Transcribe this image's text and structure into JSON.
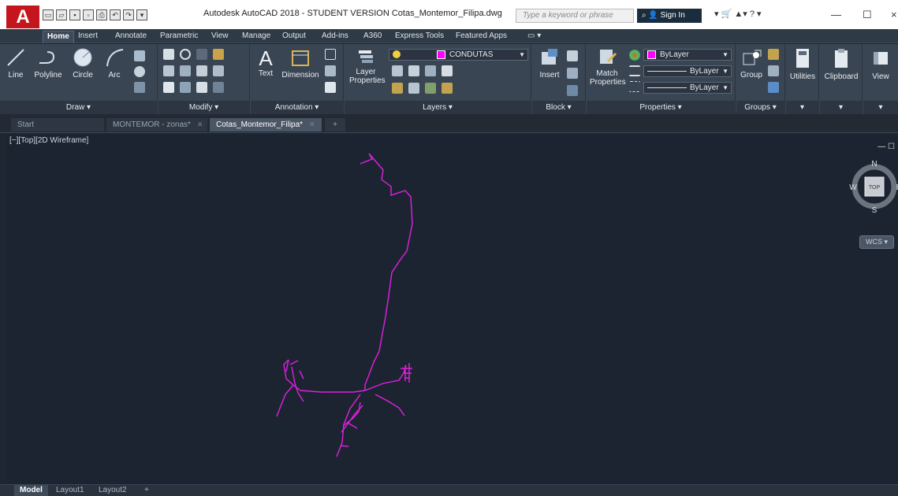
{
  "app": {
    "logo": "A",
    "window_title": "Autodesk AutoCAD 2018 - STUDENT VERSION    Cotas_Montemor_Filipa.dwg",
    "search_placeholder": "Type a keyword or phrase",
    "sign_in": "Sign In",
    "minimize": "—",
    "maximize": "☐",
    "close": "×"
  },
  "ribbon_tabs": [
    "Home",
    "Insert",
    "Annotate",
    "Parametric",
    "View",
    "Manage",
    "Output",
    "Add-ins",
    "A360",
    "Express Tools",
    "Featured Apps"
  ],
  "panels": {
    "draw": {
      "title": "Draw ▾",
      "line": "Line",
      "polyline": "Polyline",
      "circle": "Circle",
      "arc": "Arc"
    },
    "modify": {
      "title": "Modify ▾"
    },
    "annotation": {
      "title": "Annotation ▾",
      "text": "Text",
      "dimension": "Dimension"
    },
    "layers": {
      "title": "Layers ▾",
      "layer_properties_1": "Layer",
      "layer_properties_2": "Properties",
      "current_layer": "CONDUTAS"
    },
    "block": {
      "title": "Block ▾",
      "insert": "Insert"
    },
    "properties": {
      "title": "Properties ▾",
      "match_1": "Match",
      "match_2": "Properties",
      "color": "ByLayer",
      "linetype": "ByLayer",
      "lineweight": "ByLayer"
    },
    "groups": {
      "title": "Groups ▾",
      "group": "Group"
    },
    "utilities": {
      "label": "Utilities"
    },
    "clipboard": {
      "label": "Clipboard"
    },
    "view": {
      "label": "View"
    }
  },
  "doc_tabs": {
    "start": "Start",
    "tab1": "MONTEMOR - zonas*",
    "tab2": "Cotas_Montemor_Filipa*",
    "new": "+"
  },
  "viewport": {
    "label": "[−][Top][2D Wireframe]",
    "controls": "— ☐",
    "compass": {
      "n": "N",
      "s": "S",
      "w": "W",
      "e": "E",
      "top": "TOP"
    },
    "wcs": "WCS ▾"
  },
  "layout_tabs": [
    "Model",
    "Layout1",
    "Layout2",
    "+"
  ],
  "colors": {
    "accent": "#c4161c",
    "drawing_line": "#e020e0",
    "layer_swatch": "#ff00ff"
  }
}
